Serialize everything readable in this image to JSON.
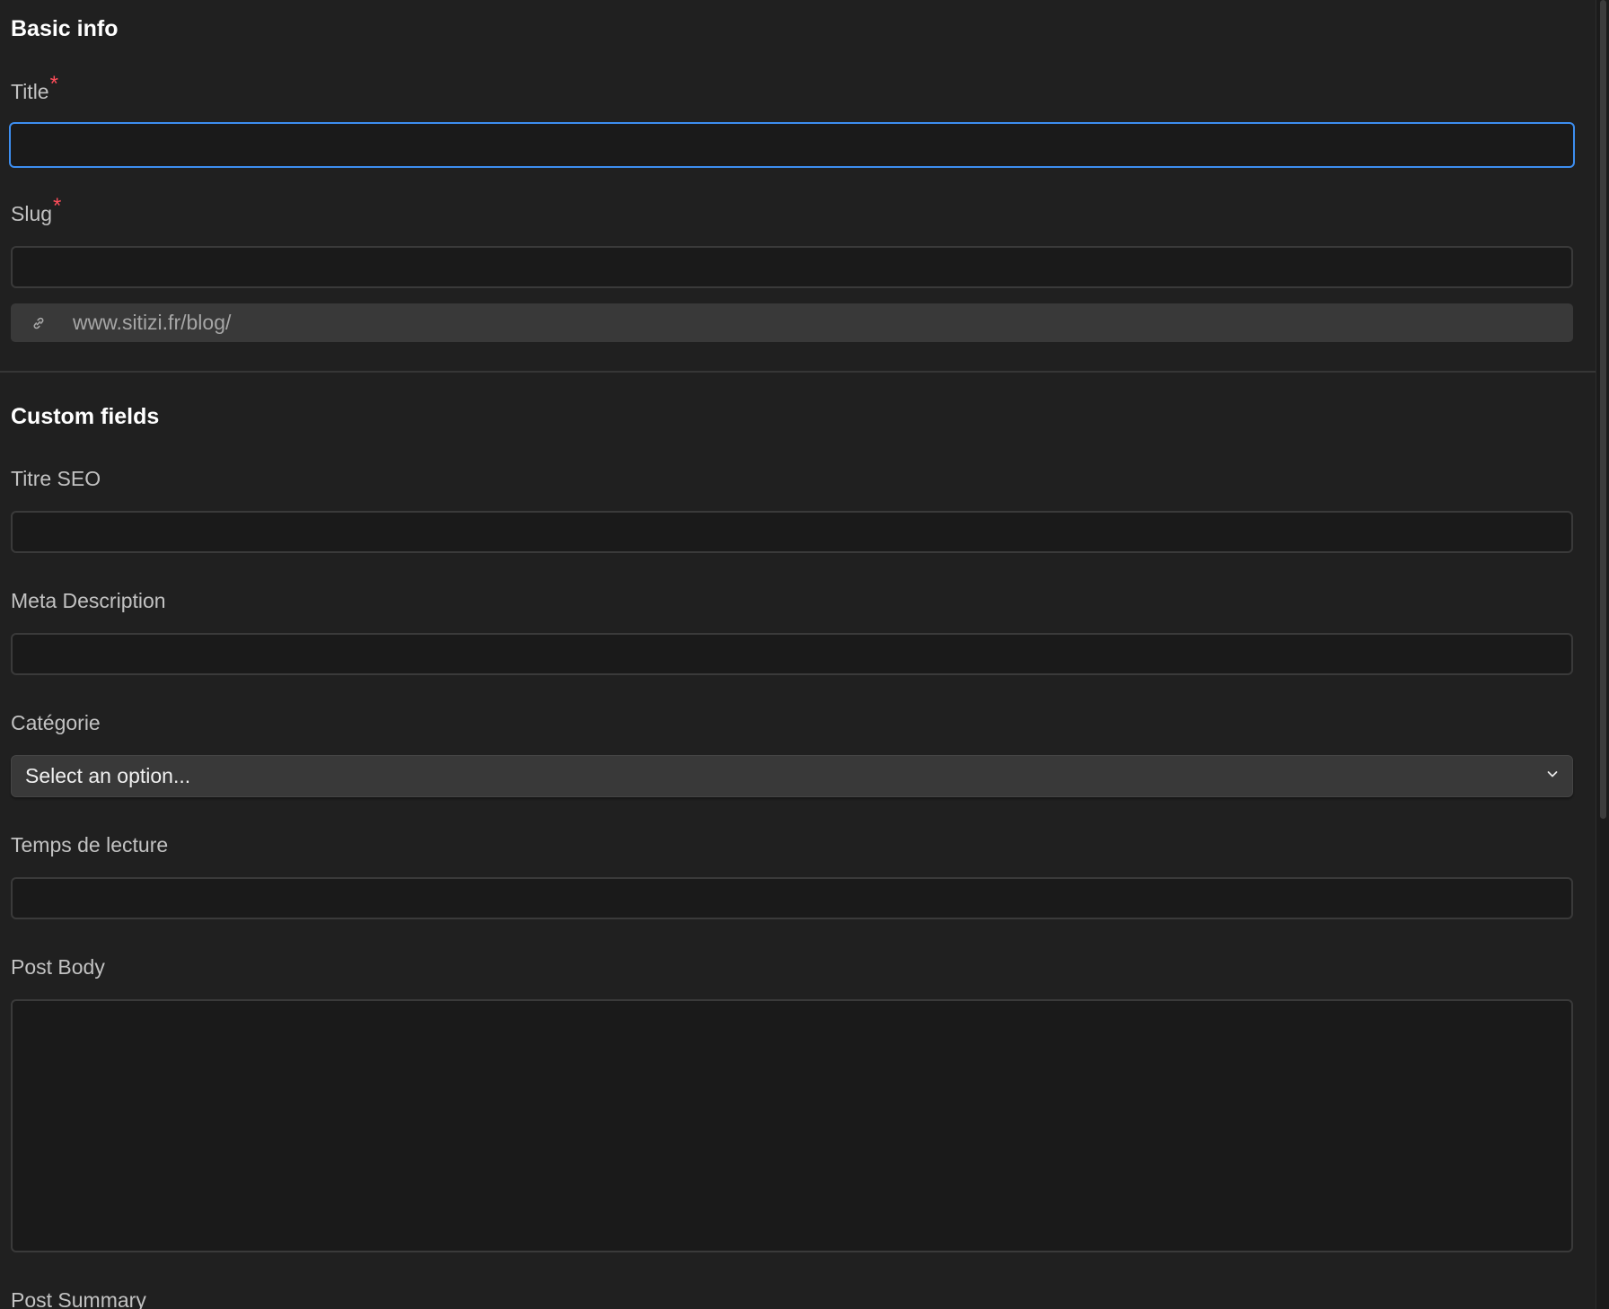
{
  "basic_info": {
    "heading": "Basic info",
    "title_field": {
      "label": "Title",
      "required_mark": "*",
      "value": ""
    },
    "slug_field": {
      "label": "Slug",
      "required_mark": "*",
      "value": ""
    },
    "url_preview": {
      "icon": "link-icon",
      "text": "www.sitizi.fr/blog/"
    }
  },
  "custom_fields": {
    "heading": "Custom fields",
    "titre_seo": {
      "label": "Titre SEO",
      "value": ""
    },
    "meta_description": {
      "label": "Meta Description",
      "value": ""
    },
    "categorie": {
      "label": "Catégorie",
      "selected": "Select an option...",
      "icon": "chevron-down-icon"
    },
    "temps_de_lecture": {
      "label": "Temps de lecture",
      "value": ""
    },
    "post_body": {
      "label": "Post Body",
      "value": ""
    },
    "post_summary": {
      "label": "Post Summary"
    }
  },
  "colors": {
    "background": "#202020",
    "input_background": "#1a1a1a",
    "focus_border": "#3d8ef0",
    "required": "#ff4d5a"
  }
}
